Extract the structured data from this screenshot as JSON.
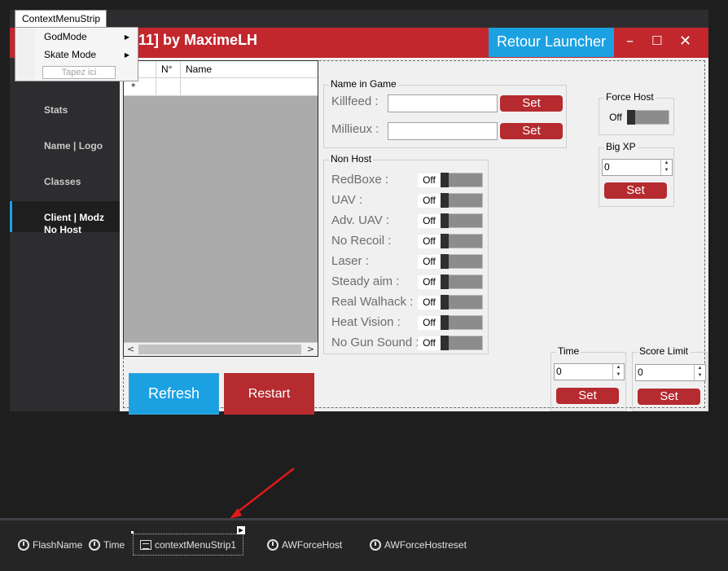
{
  "titlebar": {
    "title": "11] by MaximeLH",
    "retour_label": "Retour Launcher",
    "minimize": "–",
    "maximize": "☐",
    "close": "✕"
  },
  "sidebar": {
    "items": [
      {
        "label": "Stats"
      },
      {
        "label": "Name | Logo"
      },
      {
        "label": "Classes"
      },
      {
        "label": "Client | Modz\nNo Host",
        "line1": "Client | Modz",
        "line2": "No Host"
      }
    ]
  },
  "grid": {
    "columns": [
      "",
      "N°",
      "Name"
    ],
    "new_row_marker": "*",
    "scroll_left": "<",
    "scroll_right": ">"
  },
  "buttons": {
    "refresh": "Refresh",
    "restart": "Restart"
  },
  "name_in_game": {
    "legend": "Name in Game",
    "killfeed_label": "Killfeed :",
    "millieux_label": "Millieux :",
    "set": "Set"
  },
  "non_host": {
    "legend": "Non Host",
    "toggle_state": "Off",
    "items": [
      "RedBoxe :",
      "UAV :",
      "Adv. UAV :",
      "No Recoil :",
      "Laser :",
      "Steady aim :",
      "Real Walhack :",
      "Heat Vision :",
      "No Gun Sound :"
    ]
  },
  "force_host": {
    "legend": "Force Host",
    "state": "Off"
  },
  "big_xp": {
    "legend": "Big XP",
    "value": "0",
    "set": "Set"
  },
  "time": {
    "legend": "Time",
    "value": "0",
    "set": "Set"
  },
  "score_limit": {
    "legend": "Score Limit",
    "value": "0",
    "set": "Set"
  },
  "context_menu": {
    "tab": "ContextMenuStrip",
    "items": [
      "GodMode",
      "Skate Mode"
    ],
    "placeholder": "Tapez ici"
  },
  "tray": {
    "items": [
      "FlashName",
      "Time",
      "contextMenuStrip1",
      "AWForceHost",
      "AWForceHostreset"
    ]
  },
  "colors": {
    "accent_red": "#c1272d",
    "accent_blue": "#1ba1e2",
    "arrow": "#e0191b"
  }
}
